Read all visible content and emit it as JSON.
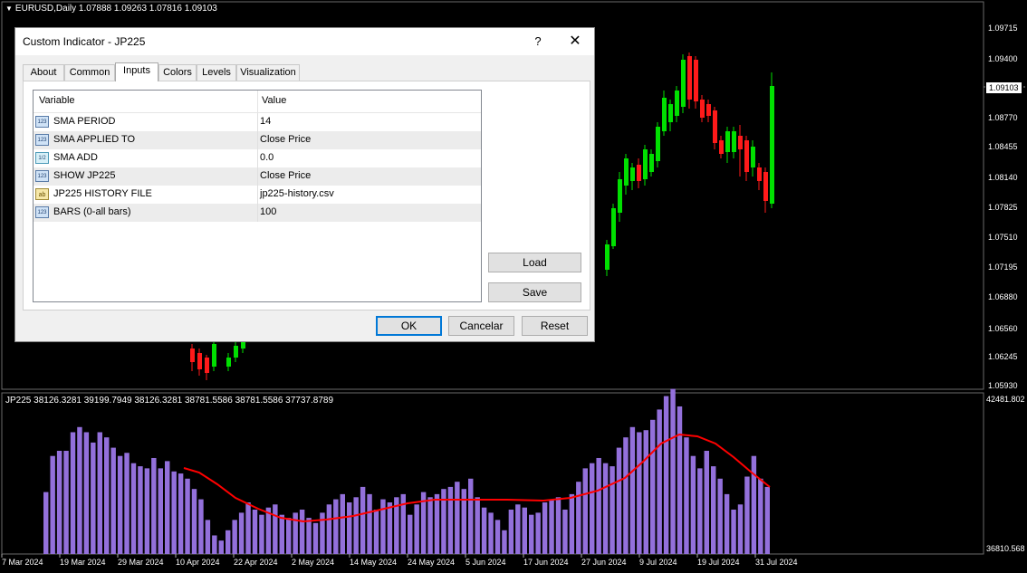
{
  "chart": {
    "price_title": "EURUSD,Daily  1.07888 1.09263 1.07816 1.09103",
    "indicator_title": "JP225 38126.3281 39199.7949 38126.3281 38781.5586 38781.5586 37737.8789",
    "current_price": "1.09103",
    "price_axis": [
      "1.09715",
      "1.09400",
      "1.08770",
      "1.08455",
      "1.08140",
      "1.07825",
      "1.07510",
      "1.07195",
      "1.06880",
      "1.06560",
      "1.06245",
      "1.05930"
    ],
    "indicator_axis": [
      "42481.802",
      "36810.568"
    ],
    "dates": [
      "7 Mar 2024",
      "19 Mar 2024",
      "29 Mar 2024",
      "10 Apr 2024",
      "22 Apr 2024",
      "2 May 2024",
      "14 May 2024",
      "24 May 2024",
      "5 Jun 2024",
      "17 Jun 2024",
      "27 Jun 2024",
      "9 Jul 2024",
      "19 Jul 2024",
      "31 Jul 2024"
    ],
    "colors": {
      "up": "#00e000",
      "down": "#ff1a1a",
      "histogram": "#9370db",
      "sma_line": "#ff0000",
      "grid": "#3a3a3a"
    }
  },
  "dialog": {
    "title": "Custom Indicator - JP225",
    "help_label": "?",
    "close_label": "✕",
    "tabs": [
      {
        "label": "About"
      },
      {
        "label": "Common"
      },
      {
        "label": "Inputs"
      },
      {
        "label": "Colors"
      },
      {
        "label": "Levels"
      },
      {
        "label": "Visualization"
      }
    ],
    "active_tab": "Inputs",
    "grid": {
      "col_variable": "Variable",
      "col_value": "Value",
      "rows": [
        {
          "icon": "123",
          "variable": "SMA PERIOD",
          "value": "14"
        },
        {
          "icon": "123",
          "variable": "SMA APPLIED TO",
          "value": "Close Price"
        },
        {
          "icon": "1/2",
          "variable": "SMA ADD",
          "value": "0.0"
        },
        {
          "icon": "123",
          "variable": "SHOW JP225",
          "value": "Close Price"
        },
        {
          "icon": "ab",
          "variable": "JP225 HISTORY FILE",
          "value": "jp225-history.csv"
        },
        {
          "icon": "123",
          "variable": "BARS (0-all bars)",
          "value": "100"
        }
      ]
    },
    "buttons": {
      "load": "Load",
      "save": "Save",
      "ok": "OK",
      "cancel": "Cancelar",
      "reset": "Reset"
    }
  }
}
